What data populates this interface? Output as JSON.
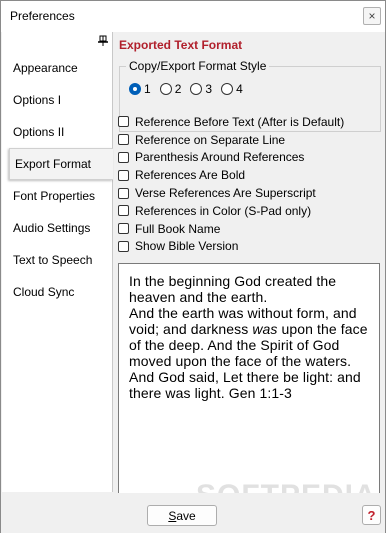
{
  "window": {
    "title": "Preferences",
    "close_glyph": "×"
  },
  "sidebar": {
    "pin_icon": "pin-icon",
    "items": [
      {
        "label": "Appearance"
      },
      {
        "label": "Options I"
      },
      {
        "label": "Options II"
      },
      {
        "label": "Export Format",
        "active": true
      },
      {
        "label": "Font Properties"
      },
      {
        "label": "Audio Settings"
      },
      {
        "label": "Text to Speech"
      },
      {
        "label": "Cloud Sync"
      }
    ]
  },
  "content": {
    "title": "Exported Text Format",
    "title_color": "#b1202c",
    "format_style": {
      "label": "Copy/Export Format Style",
      "options": [
        "1",
        "2",
        "3",
        "4"
      ],
      "selected": "1"
    },
    "checkboxes": [
      {
        "label": "Reference Before Text (After is Default)",
        "checked": false
      },
      {
        "label": "Reference on Separate Line",
        "checked": false
      },
      {
        "label": "Parenthesis Around References",
        "checked": false
      },
      {
        "label": "References Are Bold",
        "checked": false
      },
      {
        "label": "Verse References Are Superscript",
        "checked": false
      },
      {
        "label": "References in Color (S-Pad only)",
        "checked": false
      },
      {
        "label": "Full Book Name",
        "checked": false
      },
      {
        "label": "Show Bible Version",
        "checked": false
      }
    ],
    "preview": {
      "line1": "In the beginning God created the heaven and the earth.",
      "line2_a": "And the earth was without form, and void; and darkness ",
      "line2_italic": "was",
      "line2_b": " upon the face of the deep. And the Spirit of God moved upon the face of the waters.",
      "line3": "And God said, Let there be light: and there was light. Gen 1:1-3"
    }
  },
  "watermark": "SOFTPEDIA",
  "footer": {
    "save_label": "Save",
    "save_mnemonic": "S",
    "save_rest": "ave",
    "help_label": "?",
    "help_color": "#c0202c"
  }
}
